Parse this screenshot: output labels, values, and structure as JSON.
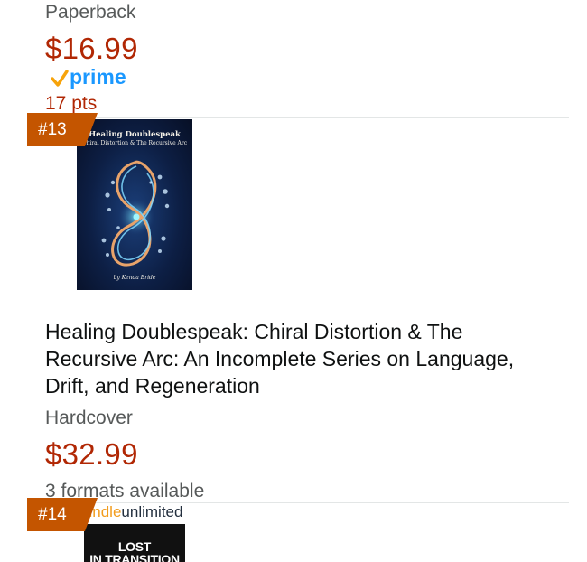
{
  "prev_item": {
    "format": "Paperback",
    "price": "$16.99",
    "prime_label": "prime",
    "points": "17 pts"
  },
  "item_13": {
    "rank": "#13",
    "cover_title_line1": "Healing Doublespeak",
    "cover_title_line2": "Chiral Distortion & The Recursive Arc",
    "cover_author": "by Kenda Bride",
    "title": "Healing Doublespeak: Chiral Distortion & The Recursive Arc: An Incomplete Series on Language, Drift, and Regeneration",
    "format": "Hardcover",
    "price": "$32.99",
    "formats_available": "3 formats available"
  },
  "item_14": {
    "rank": "#14",
    "ku_logo_kindle": "kindle",
    "ku_logo_unlimited": "unlimited",
    "cover_line1": "LOST",
    "cover_line2": "IN TRANSITION"
  },
  "colors": {
    "price_red": "#b12704",
    "prime_blue": "#1a98ff",
    "prime_check_orange": "#f7a30a",
    "rank_badge": "#c45500",
    "secondary_text": "#565959"
  }
}
